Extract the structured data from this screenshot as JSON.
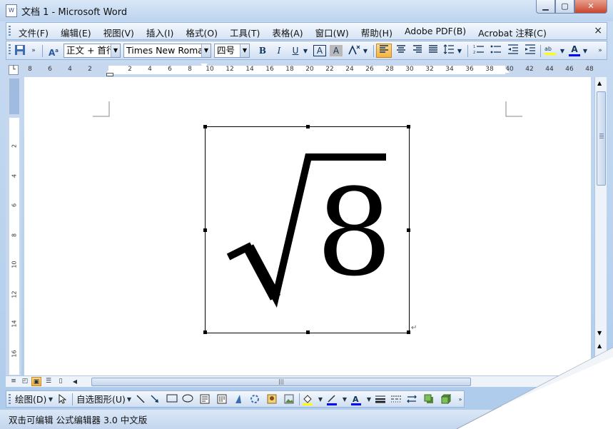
{
  "window": {
    "title": "文档 1 - Microsoft Word",
    "icon": "word-doc-icon"
  },
  "menu": {
    "items": [
      "文件(F)",
      "编辑(E)",
      "视图(V)",
      "插入(I)",
      "格式(O)",
      "工具(T)",
      "表格(A)",
      "窗口(W)",
      "帮助(H)",
      "Adobe PDF(B)",
      "Acrobat 注释(C)"
    ],
    "close_label": "×"
  },
  "toolbar": {
    "style_value": "正文 + 首行",
    "font_value": "Times New Roman",
    "size_value": "四号",
    "bold": "B",
    "italic": "I",
    "underline": "U",
    "char_border": "A",
    "char_shade": "A",
    "font_color_letter": "A"
  },
  "ruler": {
    "h_ticks": [
      "8",
      "6",
      "4",
      "2",
      "",
      "2",
      "4",
      "6",
      "8",
      "10",
      "12",
      "14",
      "16",
      "18",
      "20",
      "22",
      "24",
      "26",
      "28",
      "30",
      "32",
      "34",
      "36",
      "38",
      "40",
      "42",
      "44",
      "46",
      "48"
    ],
    "v_ticks": [
      "2",
      "4",
      "6",
      "8",
      "10",
      "12",
      "14",
      "16"
    ]
  },
  "document": {
    "formula": "√8",
    "radicand": "8",
    "paragraph_mark": "↵"
  },
  "drawbar": {
    "draw_label": "绘图(D)",
    "autoshape_label": "自选图形(U)"
  },
  "status": {
    "text": "双击可编辑 公式编辑器 3.0 中文版"
  },
  "colors": {
    "accent": "#f5b340",
    "chrome": "#c7d8ee",
    "highlight": "#ffff00",
    "font_color": "#0000ff"
  }
}
